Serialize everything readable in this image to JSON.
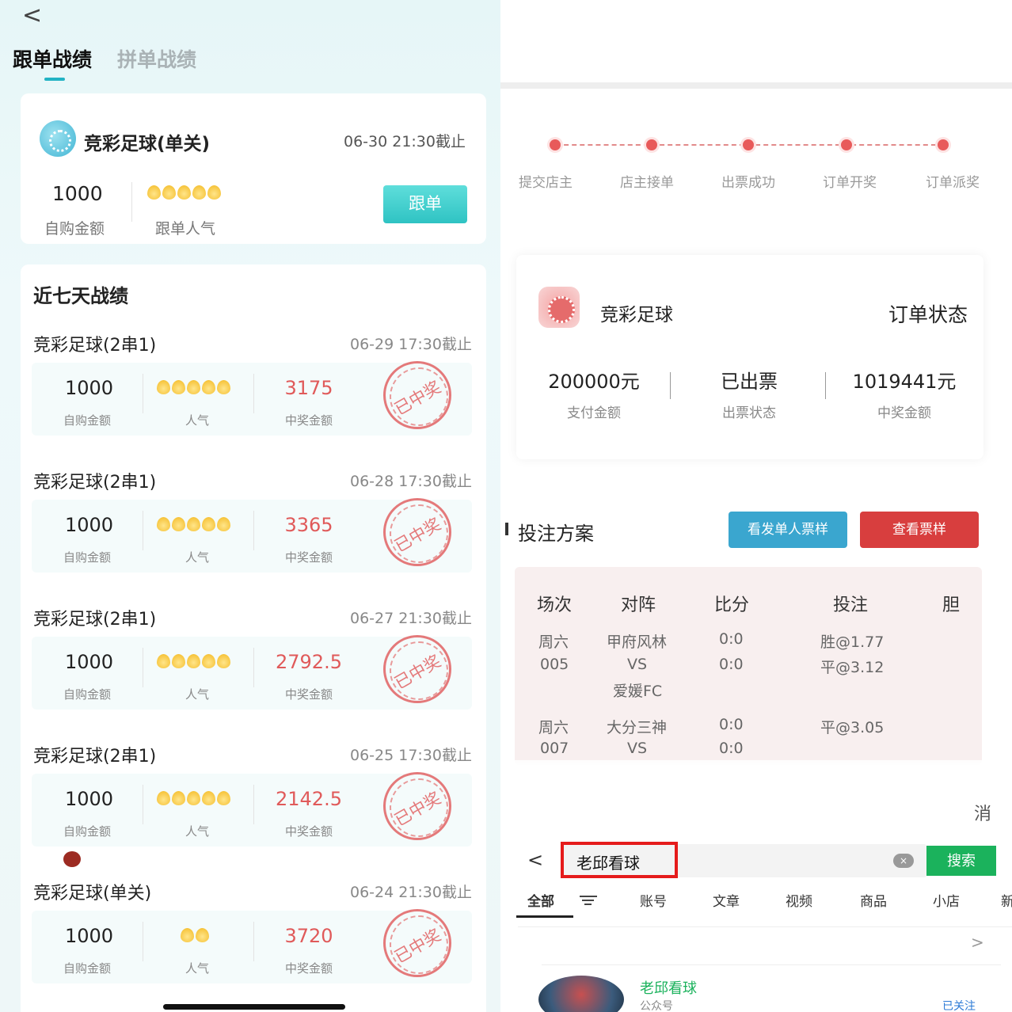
{
  "left": {
    "back_glyph": "<",
    "tabs": [
      "跟单战绩",
      "拼单战绩"
    ],
    "main_card": {
      "title": "竞彩足球(单关)",
      "deadline": "06-30 21:30截止",
      "amount": "1000",
      "amount_label": "自购金额",
      "popularity_label": "跟单人气",
      "popularity_level": 5,
      "follow_button": "跟单"
    },
    "recent": {
      "heading": "近七天战绩",
      "rows": [
        {
          "title": "竞彩足球(2串1)",
          "deadline": "06-29 17:30截止",
          "amount": "1000",
          "amount_label": "自购金额",
          "popularity": 5,
          "popularity_label": "人气",
          "win": "3175",
          "win_label": "中奖金额",
          "stamp": "已中奖"
        },
        {
          "title": "竞彩足球(2串1)",
          "deadline": "06-28 17:30截止",
          "amount": "1000",
          "amount_label": "自购金额",
          "popularity": 5,
          "popularity_label": "人气",
          "win": "3365",
          "win_label": "中奖金额",
          "stamp": "已中奖"
        },
        {
          "title": "竞彩足球(2串1)",
          "deadline": "06-27 21:30截止",
          "amount": "1000",
          "amount_label": "自购金额",
          "popularity": 5,
          "popularity_label": "人气",
          "win": "2792.5",
          "win_label": "中奖金额",
          "stamp": "已中奖"
        },
        {
          "title": "竞彩足球(2串1)",
          "deadline": "06-25 17:30截止",
          "amount": "1000",
          "amount_label": "自购金额",
          "popularity": 5,
          "popularity_label": "人气",
          "win": "2142.5",
          "win_label": "中奖金额",
          "stamp": "已中奖"
        },
        {
          "title": "竞彩足球(单关)",
          "deadline": "06-24 21:30截止",
          "amount": "1000",
          "amount_label": "自购金额",
          "popularity": 2,
          "popularity_label": "人气",
          "win": "3720",
          "win_label": "中奖金额",
          "stamp": "已中奖"
        }
      ]
    }
  },
  "right": {
    "steps": [
      "提交店主",
      "店主接单",
      "出票成功",
      "订单开奖",
      "订单派奖"
    ],
    "order": {
      "title": "竞彩足球",
      "status_title": "订单状态",
      "cols": [
        {
          "value": "200000元",
          "label": "支付金额"
        },
        {
          "value": "已出票",
          "label": "出票状态"
        },
        {
          "value": "1019441元",
          "label": "中奖金额"
        }
      ]
    },
    "plan": {
      "title": "投注方案",
      "btn_sample": "看发单人票样",
      "btn_view": "查看票样",
      "headers": [
        "场次",
        "对阵",
        "比分",
        "投注",
        "胆"
      ],
      "r1": {
        "day": "周六",
        "num": "005",
        "home": "甲府风林",
        "vs": "VS",
        "away": "爱媛FC",
        "s1": "0:0",
        "s2": "0:0",
        "b1": "胜@1.77",
        "b2": "平@3.12"
      },
      "r2": {
        "day": "周六",
        "num": "007",
        "home": "大分三神",
        "vs": "VS",
        "s1": "0:0",
        "s2": "0:0",
        "b1": "平@3.05"
      }
    },
    "search": {
      "cancel": "消",
      "back_glyph": "<",
      "query": "老邱看球",
      "clear_glyph": "×",
      "button": "搜索",
      "tabs": [
        "全部",
        "账号",
        "文章",
        "视频",
        "商品",
        "小店",
        "新"
      ],
      "chevron": ">",
      "result": {
        "name": "老邱看球",
        "type": "公众号",
        "status": "已关注"
      }
    }
  }
}
